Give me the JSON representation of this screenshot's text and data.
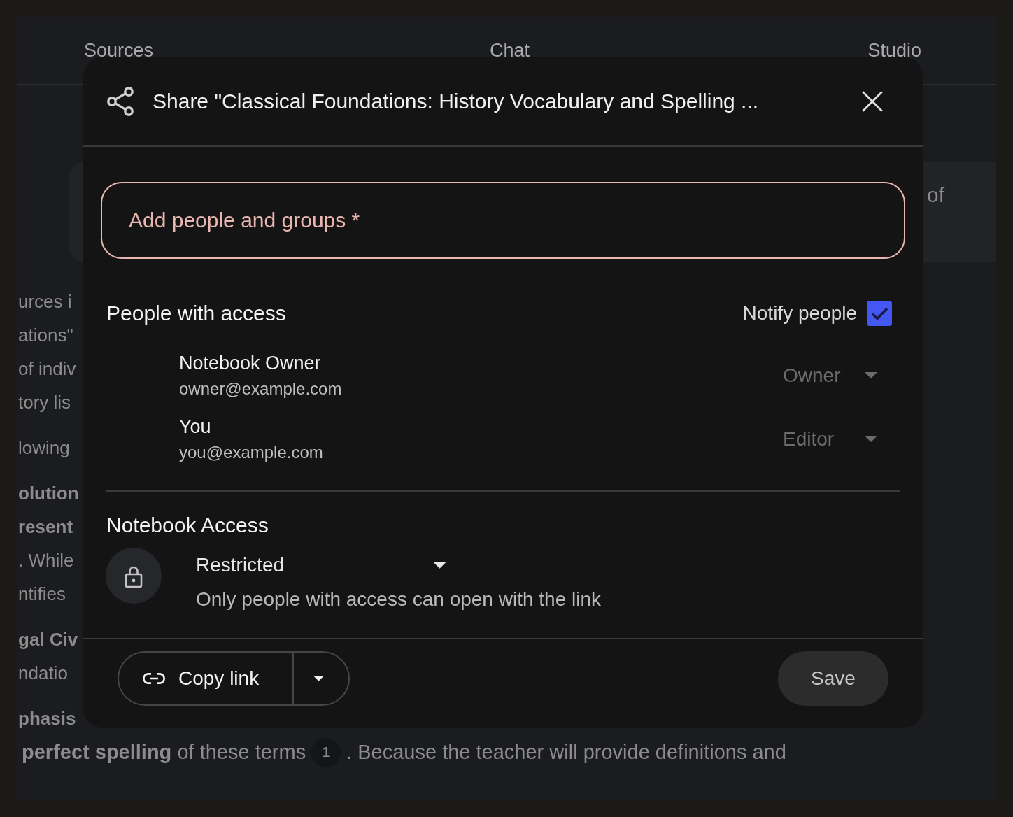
{
  "background": {
    "tabs": [
      {
        "label": "Sources"
      },
      {
        "label": "Chat"
      },
      {
        "label": "Studio"
      }
    ],
    "card_text": "of",
    "paragraphs": [
      {
        "lines": [
          {
            "text": "urces i",
            "bold": false
          },
          {
            "text": "ations\"",
            "bold": false
          },
          {
            "text": "of indiv",
            "bold": false
          },
          {
            "text": "tory lis",
            "bold": false
          }
        ]
      },
      {
        "lines": [
          {
            "text": "lowing",
            "bold": false
          }
        ]
      },
      {
        "lines": [
          {
            "text": "olution",
            "bold": true
          },
          {
            "text": "resent",
            "bold": true
          },
          {
            "text": ". While",
            "bold": false
          },
          {
            "text": "ntifies",
            "bold": false
          }
        ]
      },
      {
        "lines": [
          {
            "text": "gal Civ",
            "bold": true
          },
          {
            "text": "ndatio",
            "bold": false
          }
        ]
      },
      {
        "lines": [
          {
            "text": "phasis",
            "bold": true
          }
        ],
        "cited_line": {
          "before": "**perfect spelling** of these terms",
          "citation": "1",
          "after": ". Because the teacher will provide definitions and"
        }
      }
    ]
  },
  "dialog": {
    "title": "Share \"Classical Foundations: History Vocabulary and Spelling ...",
    "add_people": {
      "placeholder": "Add people and groups *"
    },
    "people": {
      "heading": "People with access",
      "notify": {
        "label": "Notify people",
        "checked": true
      },
      "members": [
        {
          "name": "Notebook Owner",
          "email": "owner@example.com",
          "role": "Owner",
          "disabled": true
        },
        {
          "name": "You",
          "email": "you@example.com",
          "role": "Editor",
          "disabled": true
        }
      ]
    },
    "access": {
      "heading": "Notebook Access",
      "level": "Restricted",
      "description": "Only people with access can open with the link"
    },
    "footer": {
      "copy_link": "Copy link",
      "save": {
        "label": "Save",
        "disabled": true
      }
    }
  }
}
